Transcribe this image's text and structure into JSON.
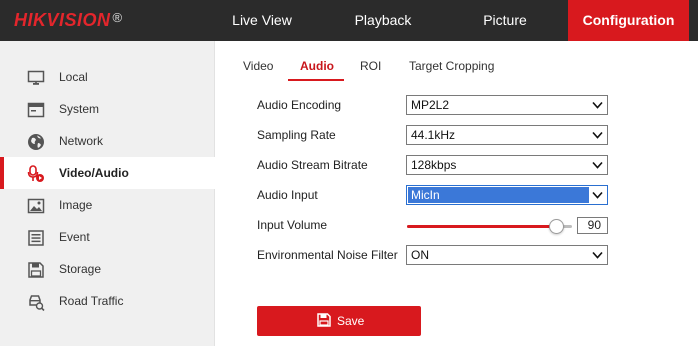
{
  "brand": {
    "logo": "HIKVISION",
    "registered": "®"
  },
  "nav": {
    "live_view": "Live View",
    "playback": "Playback",
    "picture": "Picture",
    "configuration": "Configuration"
  },
  "sidebar": {
    "items": [
      {
        "label": "Local",
        "icon": "monitor-icon"
      },
      {
        "label": "System",
        "icon": "system-icon"
      },
      {
        "label": "Network",
        "icon": "globe-icon"
      },
      {
        "label": "Video/Audio",
        "icon": "microphone-icon",
        "active": true
      },
      {
        "label": "Image",
        "icon": "image-icon"
      },
      {
        "label": "Event",
        "icon": "event-list-icon"
      },
      {
        "label": "Storage",
        "icon": "storage-icon"
      },
      {
        "label": "Road Traffic",
        "icon": "road-traffic-icon"
      }
    ]
  },
  "tabs": {
    "video": "Video",
    "audio": "Audio",
    "roi": "ROI",
    "target_cropping": "Target Cropping"
  },
  "form": {
    "audio_encoding": {
      "label": "Audio Encoding",
      "value": "MP2L2"
    },
    "sampling_rate": {
      "label": "Sampling Rate",
      "value": "44.1kHz"
    },
    "audio_stream_bitrate": {
      "label": "Audio Stream Bitrate",
      "value": "128kbps"
    },
    "audio_input": {
      "label": "Audio Input",
      "value": "MicIn"
    },
    "input_volume": {
      "label": "Input Volume",
      "value": "90",
      "level": 0.9
    },
    "noise_filter": {
      "label": "Environmental Noise Filter",
      "value": "ON"
    }
  },
  "actions": {
    "save_label": "Save"
  },
  "colors": {
    "accent": "#d8191e",
    "topbar": "#2b2b2b",
    "selection": "#3b78d8"
  }
}
